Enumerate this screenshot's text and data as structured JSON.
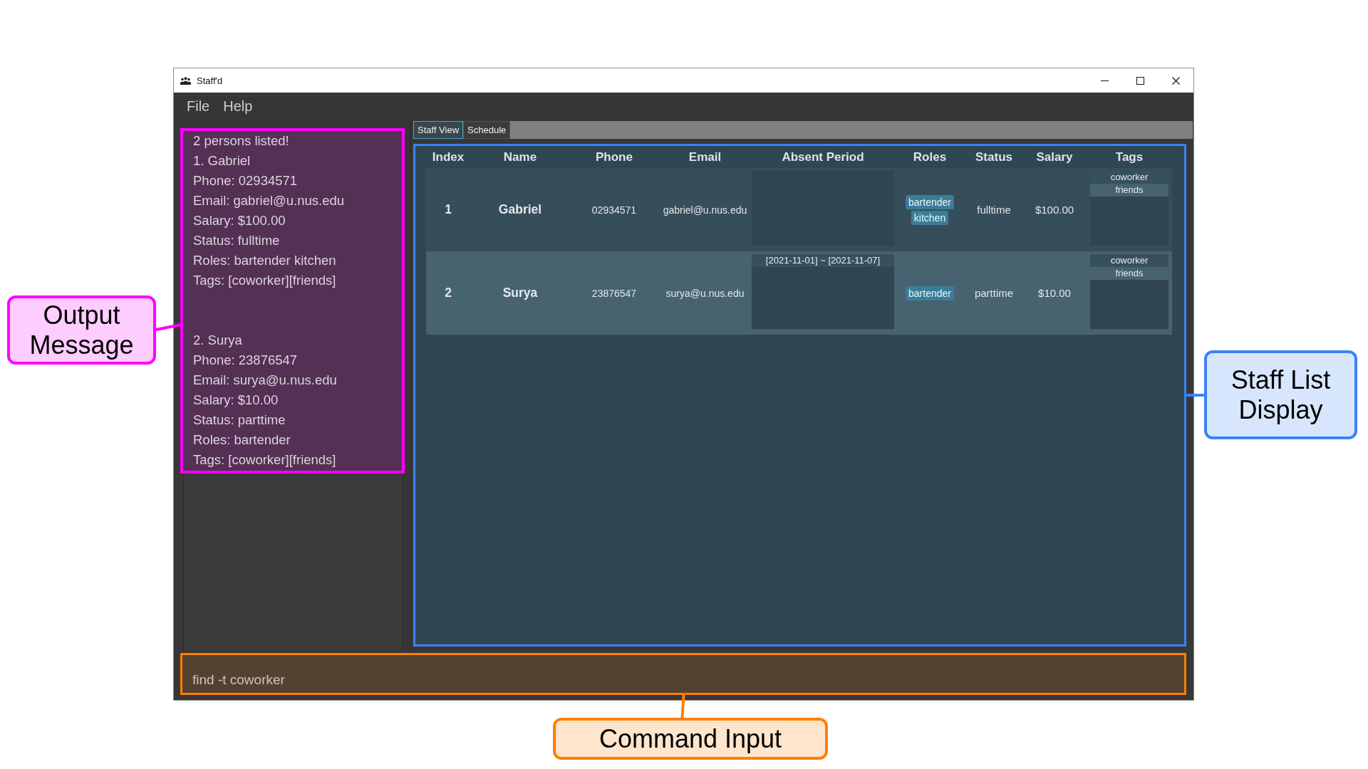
{
  "window": {
    "title": "Staff'd"
  },
  "menu": [
    "File",
    "Help"
  ],
  "output_message": {
    "blocks": [
      [
        "2 persons listed!",
        "1. Gabriel",
        "Phone: 02934571",
        "Email: gabriel@u.nus.edu",
        "Salary: $100.00",
        "Status: fulltime",
        "Roles: bartender kitchen",
        "Tags: [coworker][friends]"
      ],
      [
        "2. Surya",
        "Phone: 23876547",
        "Email: surya@u.nus.edu",
        "Salary: $10.00",
        "Status: parttime",
        "Roles: bartender",
        "Tags: [coworker][friends]"
      ]
    ]
  },
  "tabs": [
    {
      "label": "Staff View",
      "selected": true
    },
    {
      "label": "Schedule",
      "selected": false
    }
  ],
  "staff_table": {
    "columns": [
      "Index",
      "Name",
      "Phone",
      "Email",
      "Absent Period",
      "Roles",
      "Status",
      "Salary",
      "Tags"
    ],
    "rows": [
      {
        "selected": false,
        "index": "1",
        "name": "Gabriel",
        "phone": "02934571",
        "email": "gabriel@u.nus.edu",
        "roles": [
          "bartender",
          "kitchen"
        ],
        "status": "fulltime",
        "salary": "$100.00",
        "tags": [
          "coworker",
          "friends"
        ]
      },
      {
        "selected": true,
        "index": "2",
        "name": "Surya",
        "phone": "23876547",
        "email": "surya@u.nus.edu",
        "absent_periods": [
          "[2021-11-01] ~ [2021-11-07]"
        ],
        "roles": [
          "bartender"
        ],
        "status": "parttime",
        "salary": "$10.00",
        "tags": [
          "coworker",
          "friends"
        ]
      }
    ]
  },
  "command_box": {
    "value": "find -t coworker"
  },
  "annotations": [
    {
      "label": "Output Message",
      "color": "#ff00ff"
    },
    {
      "label": "Staff List Display",
      "color": "#3b82f6"
    },
    {
      "label": "Command Input",
      "color": "#ff7f00"
    }
  ]
}
